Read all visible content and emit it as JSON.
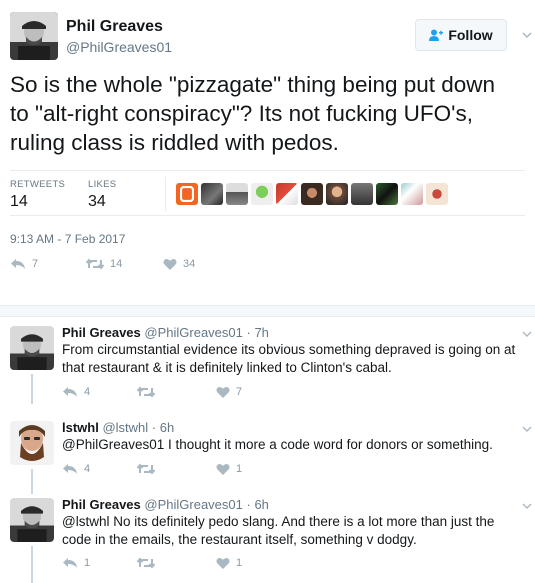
{
  "tweet": {
    "name": "Phil Greaves",
    "handle": "@PhilGreaves01",
    "follow_label": "Follow",
    "text": "So is the whole \"pizzagate\" thing being put down to \"alt-right conspiracy\"? Its not fucking UFO's, ruling class is riddled with pedos.",
    "retweets_label": "RETWEETS",
    "retweets": "14",
    "likes_label": "LIKES",
    "likes": "34",
    "timestamp": "9:13 AM - 7 Feb 2017",
    "reply_count": "7",
    "retweet_count": "14",
    "like_count": "34"
  },
  "replies": [
    {
      "name": "Phil Greaves",
      "handle": "@PhilGreaves01",
      "time": "· 7h",
      "text": "From circumstantial evidence its obvious something depraved is going on at that restaurant & it is definitely linked to Clinton's cabal.",
      "reply_count": "4",
      "retweet_count": "",
      "like_count": "7"
    },
    {
      "name": "lstwhl",
      "handle": "@lstwhl",
      "time": "· 6h",
      "text": "@PhilGreaves01 I thought it more a code word for donors or something.",
      "reply_count": "4",
      "retweet_count": "",
      "like_count": "1"
    },
    {
      "name": "Phil Greaves",
      "handle": "@PhilGreaves01",
      "time": "· 6h",
      "text": "@lstwhl No its definitely pedo slang. And there is a lot more than just the code in the emails, the restaurant itself, something v dodgy.",
      "reply_count": "1",
      "retweet_count": "",
      "like_count": "1"
    }
  ],
  "colors": {
    "accent": "#1da1f2",
    "icon_gray": "#aab8c2",
    "text_gray": "#657786",
    "liker_orange": "#f26522"
  },
  "icons": [
    "follow-person-icon",
    "chevron-down-icon",
    "reply-icon",
    "retweet-icon",
    "heart-icon"
  ]
}
